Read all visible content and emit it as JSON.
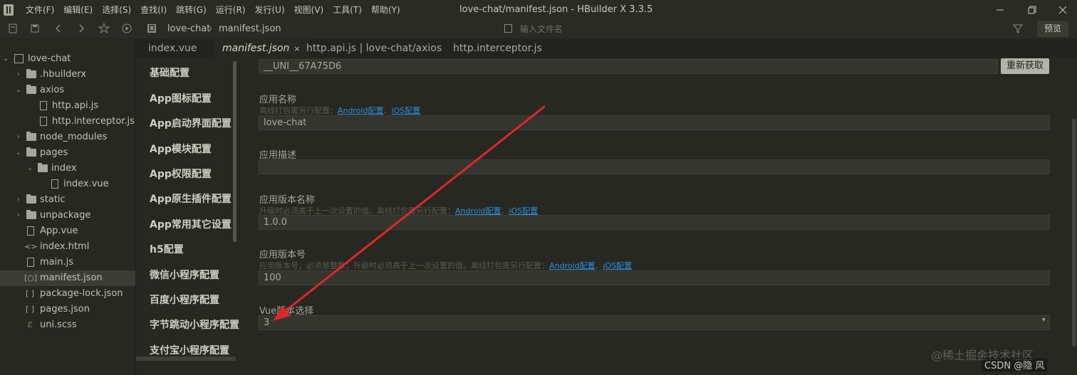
{
  "menubar": {
    "items": [
      "文件(F)",
      "编辑(E)",
      "选择(S)",
      "查找(I)",
      "跳转(G)",
      "运行(R)",
      "发行(U)",
      "视图(V)",
      "工具(T)",
      "帮助(Y)"
    ],
    "window_title": "love-chat/manifest.json - HBuilder X 3.3.5"
  },
  "toolbar": {
    "breadcrumb": [
      "love-chat",
      "manifest.json"
    ],
    "search_placeholder": "输入文件名",
    "preview_label": "预览"
  },
  "tree": {
    "root": "love-chat",
    "items": [
      {
        "label": ".hbuilderx"
      },
      {
        "label": "axios"
      },
      {
        "label": "http.api.js"
      },
      {
        "label": "http.interceptor.js"
      },
      {
        "label": "node_modules"
      },
      {
        "label": "pages"
      },
      {
        "label": "index"
      },
      {
        "label": "index.vue"
      },
      {
        "label": "static"
      },
      {
        "label": "unpackage"
      },
      {
        "label": "App.vue"
      },
      {
        "label": "index.html"
      },
      {
        "label": "main.js"
      },
      {
        "label": "manifest.json"
      },
      {
        "label": "package-lock.json"
      },
      {
        "label": "pages.json"
      },
      {
        "label": "uni.scss"
      }
    ]
  },
  "tabs": [
    "index.vue",
    "manifest.json",
    "http.api.js | love-chat/axios",
    "http.interceptor.js"
  ],
  "nav": [
    "基础配置",
    "App图标配置",
    "App启动界面配置",
    "App模块配置",
    "App权限配置",
    "App原生插件配置",
    "App常用其它设置",
    "h5配置",
    "微信小程序配置",
    "百度小程序配置",
    "字节跳动小程序配置",
    "支付宝小程序配置"
  ],
  "form": {
    "appid_value": "__UNI__67A75D6",
    "refresh_label": "重新获取",
    "app_name": {
      "label": "应用名称",
      "hint_prefix": "离线打包需另行配置：",
      "link1": "Android配置",
      "sep": "、",
      "link2": "iOS配置",
      "value": "love-chat"
    },
    "app_desc": {
      "label": "应用描述",
      "value": ""
    },
    "version_name": {
      "label": "应用版本名称",
      "hint_prefix": "升级时必须高于上一次设置的值。离线打包需另行配置：",
      "link1": "Android配置",
      "sep": "、",
      "link2": "iOS配置",
      "value": "1.0.0"
    },
    "version_code": {
      "label": "应用版本号",
      "hint_prefix": "应用版本号，必须是整数；升级时必须高于上一次设置的值。离线打包需另行配置：",
      "link1": "Android配置",
      "sep": "、",
      "link2": "iOS配置",
      "value": "100"
    },
    "vue_version": {
      "label": "Vue版本选择",
      "value": "3"
    }
  },
  "watermark": {
    "line1": "@稀土掘金技术社区",
    "line2": "CSDN @隐 风"
  },
  "colors": {
    "background": "#272822",
    "link": "#2f8ed8",
    "annotation_arrow": "#e0262b"
  }
}
